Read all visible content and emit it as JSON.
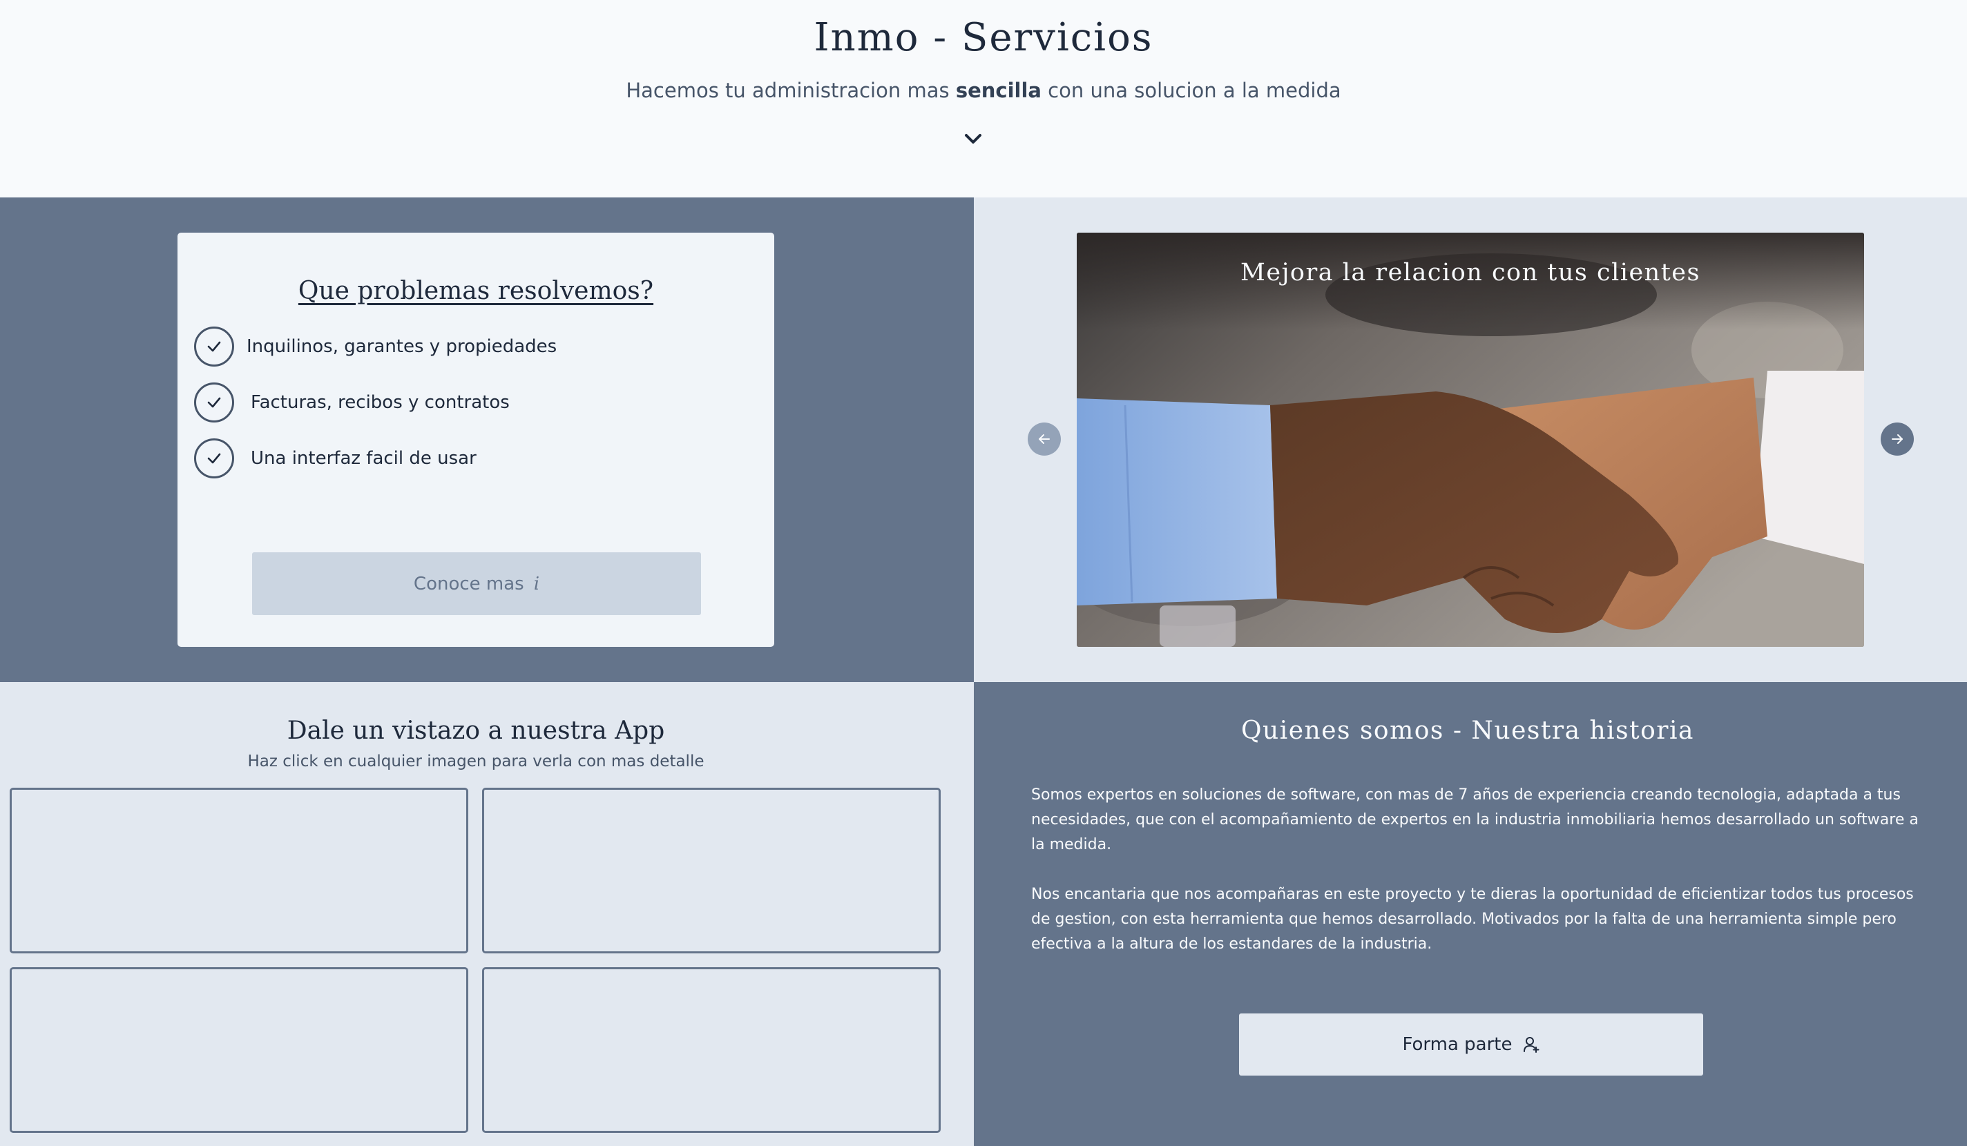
{
  "hero": {
    "title": "Inmo - Servicios",
    "subtitle_before": "Hacemos tu administracion mas ",
    "subtitle_bold": "sencilla",
    "subtitle_after": " con una solucion a la medida",
    "scroll_icon": "chevron-down-icon"
  },
  "problems": {
    "title": "Que problemas resolvemos?",
    "items": [
      {
        "label": "Inquilinos, garantes y propiedades",
        "icon": "check-circle-icon"
      },
      {
        "label": "Facturas, recibos y contratos",
        "icon": "check-circle-icon"
      },
      {
        "label": "Una interfaz facil de usar",
        "icon": "check-circle-icon"
      }
    ],
    "button_label": "Conoce mas",
    "button_icon": "info-icon"
  },
  "carousel": {
    "caption": "Mejora la relacion con tus clientes",
    "image": "handshake-photo",
    "prev_icon": "arrow-left-icon",
    "next_icon": "arrow-right-icon"
  },
  "app": {
    "title": "Dale un vistazo a nuestra App",
    "subtitle": "Haz click en cualquier imagen para verla con mas detalle",
    "thumbnails": 4
  },
  "about": {
    "title": "Quienes somos - Nuestra historia",
    "paragraphs": [
      "Somos expertos en soluciones de software, con mas de 7 años de experiencia creando tecnologia, adaptada a tus necesidades, que con el acompañamiento de expertos en la industria inmobiliaria hemos desarrollado un software a la medida.",
      "Nos encantaria que nos acompañaras en este proyecto y te dieras la oportunidad de eficientizar todos tus procesos de gestion, con esta herramienta que hemos desarrollado. Motivados por la falta de una herramienta simple pero efectiva a la altura de los estandares de la industria."
    ],
    "button_label": "Forma parte",
    "button_icon": "user-plus-icon"
  },
  "colors": {
    "slate_dark": "#64748b",
    "slate_light": "#e2e8f0",
    "button_muted": "#cbd5e1",
    "text_dark": "#1e293b"
  }
}
